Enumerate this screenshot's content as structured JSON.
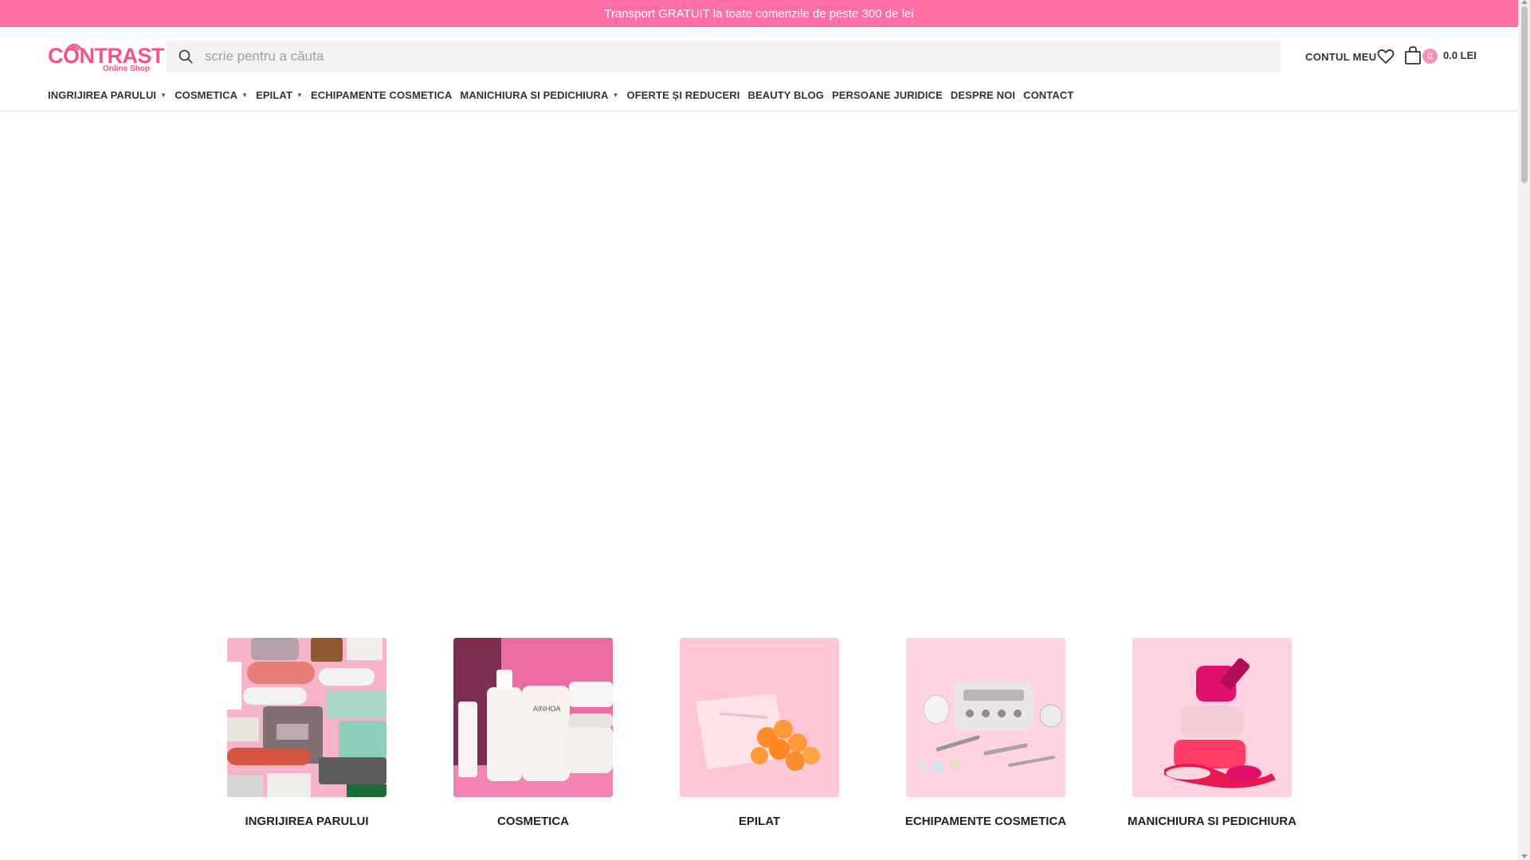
{
  "promo": {
    "text": "Transport GRATUIT la toate comenzile de peste 300 de lei"
  },
  "header": {
    "logo_text": "CONTRAST",
    "logo_sub": "Online Shop",
    "search_placeholder": "scrie pentru a căuta",
    "account_label": "CONTUL MEU",
    "cart_count": "0",
    "cart_total": "0.0 LEI"
  },
  "nav": {
    "items": [
      {
        "label": "INGRIJIREA PARULUI",
        "has_dropdown": true
      },
      {
        "label": "COSMETICA",
        "has_dropdown": true
      },
      {
        "label": "EPILAT",
        "has_dropdown": true
      },
      {
        "label": "ECHIPAMENTE COSMETICA",
        "has_dropdown": false
      },
      {
        "label": "MANICHIURA SI PEDICHIURA",
        "has_dropdown": true
      },
      {
        "label": "OFERTE ȘI REDUCERI",
        "has_dropdown": false
      },
      {
        "label": "BEAUTY BLOG",
        "has_dropdown": false
      },
      {
        "label": "PERSOANE JURIDICE",
        "has_dropdown": false
      },
      {
        "label": "DESPRE NOI",
        "has_dropdown": false
      },
      {
        "label": "CONTACT",
        "has_dropdown": false
      }
    ]
  },
  "categories": [
    {
      "label": "INGRIJIREA PARULUI"
    },
    {
      "label": "COSMETICA"
    },
    {
      "label": "EPILAT"
    },
    {
      "label": "ECHIPAMENTE COSMETICA"
    },
    {
      "label": "MANICHIURA SI PEDICHIURA"
    }
  ],
  "colors": {
    "brand_pink": "#f4518d",
    "promo_bg": "#ff6fa5",
    "cart_badge": "#ff8db6"
  }
}
